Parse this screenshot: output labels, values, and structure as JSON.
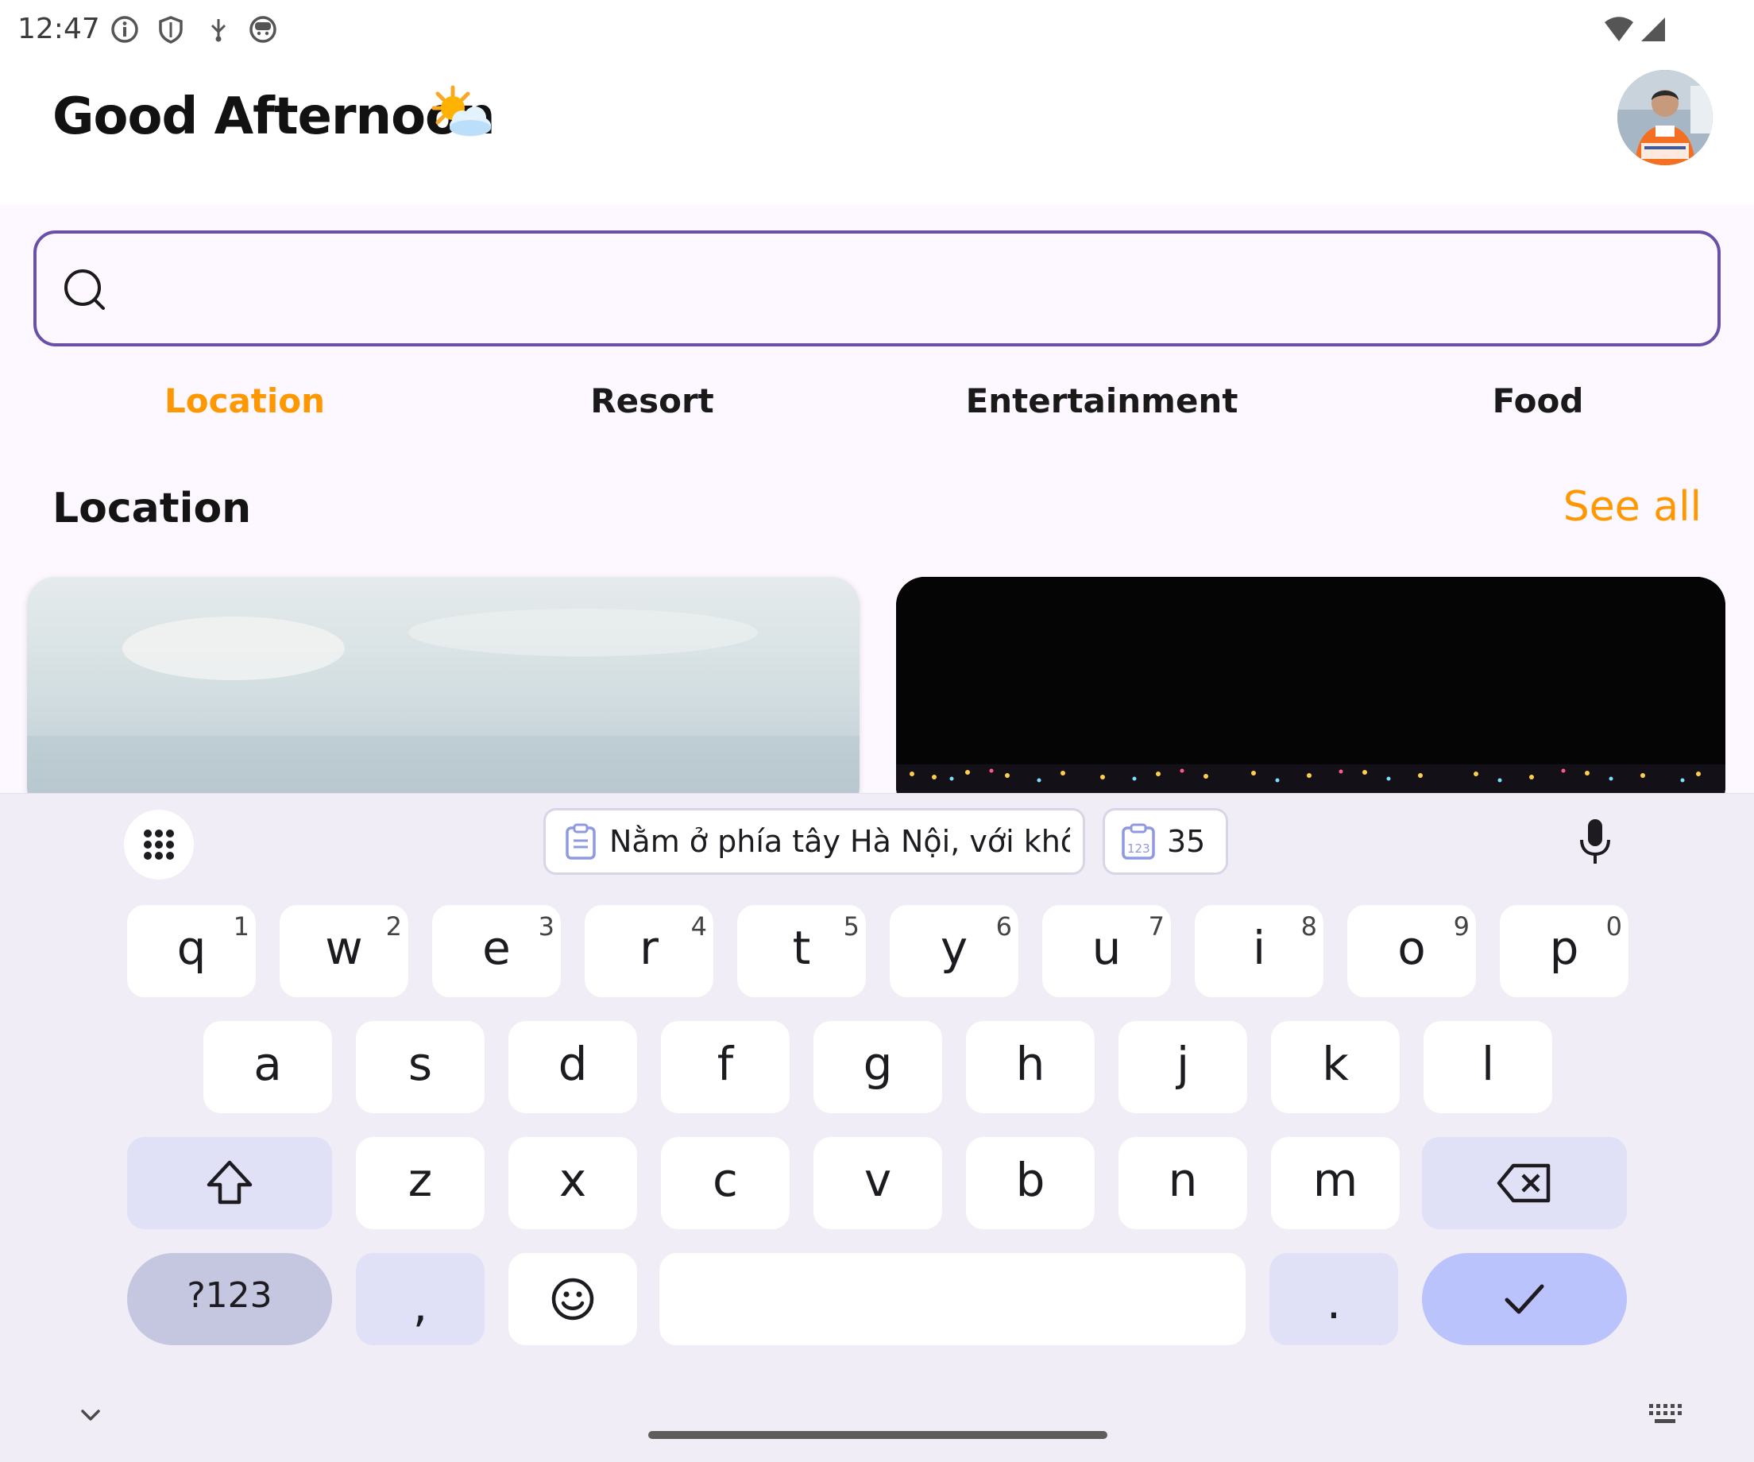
{
  "status_bar": {
    "time": "12:47",
    "icons": [
      "info-icon",
      "shield-icon",
      "usb-debug-icon",
      "android-face-icon"
    ],
    "right_icons": [
      "wifi-icon",
      "cellular-signal-icon"
    ]
  },
  "header": {
    "greeting": "Good Afternoon",
    "weather_icon": "sun-behind-cloud-icon",
    "avatar": "user-avatar"
  },
  "search": {
    "placeholder": "",
    "value": ""
  },
  "tabs": [
    {
      "label": "Location",
      "active": true
    },
    {
      "label": "Resort",
      "active": false
    },
    {
      "label": "Entertainment",
      "active": false
    },
    {
      "label": "Food",
      "active": false
    }
  ],
  "section": {
    "title": "Location",
    "see_all": "See all"
  },
  "cards": [
    {
      "image": "misty-sky-landscape"
    },
    {
      "image": "city-lights-at-night"
    }
  ],
  "keyboard": {
    "clipboard_suggestion": "Nằm ở phía tây Hà Nội, với khô...",
    "number_suggestion": "35",
    "row1": [
      {
        "key": "q",
        "hint": "1"
      },
      {
        "key": "w",
        "hint": "2"
      },
      {
        "key": "e",
        "hint": "3"
      },
      {
        "key": "r",
        "hint": "4"
      },
      {
        "key": "t",
        "hint": "5"
      },
      {
        "key": "y",
        "hint": "6"
      },
      {
        "key": "u",
        "hint": "7"
      },
      {
        "key": "i",
        "hint": "8"
      },
      {
        "key": "o",
        "hint": "9"
      },
      {
        "key": "p",
        "hint": "0"
      }
    ],
    "row2": [
      "a",
      "s",
      "d",
      "f",
      "g",
      "h",
      "j",
      "k",
      "l"
    ],
    "row3": [
      "z",
      "x",
      "c",
      "v",
      "b",
      "n",
      "m"
    ],
    "sym_label": "?123",
    "comma": ",",
    "period": ".",
    "colors": {
      "accent": "#ff9800",
      "search_border": "#6a4fa7",
      "enter_key": "#bac3fb",
      "func_key": "#e0e1f6"
    }
  }
}
